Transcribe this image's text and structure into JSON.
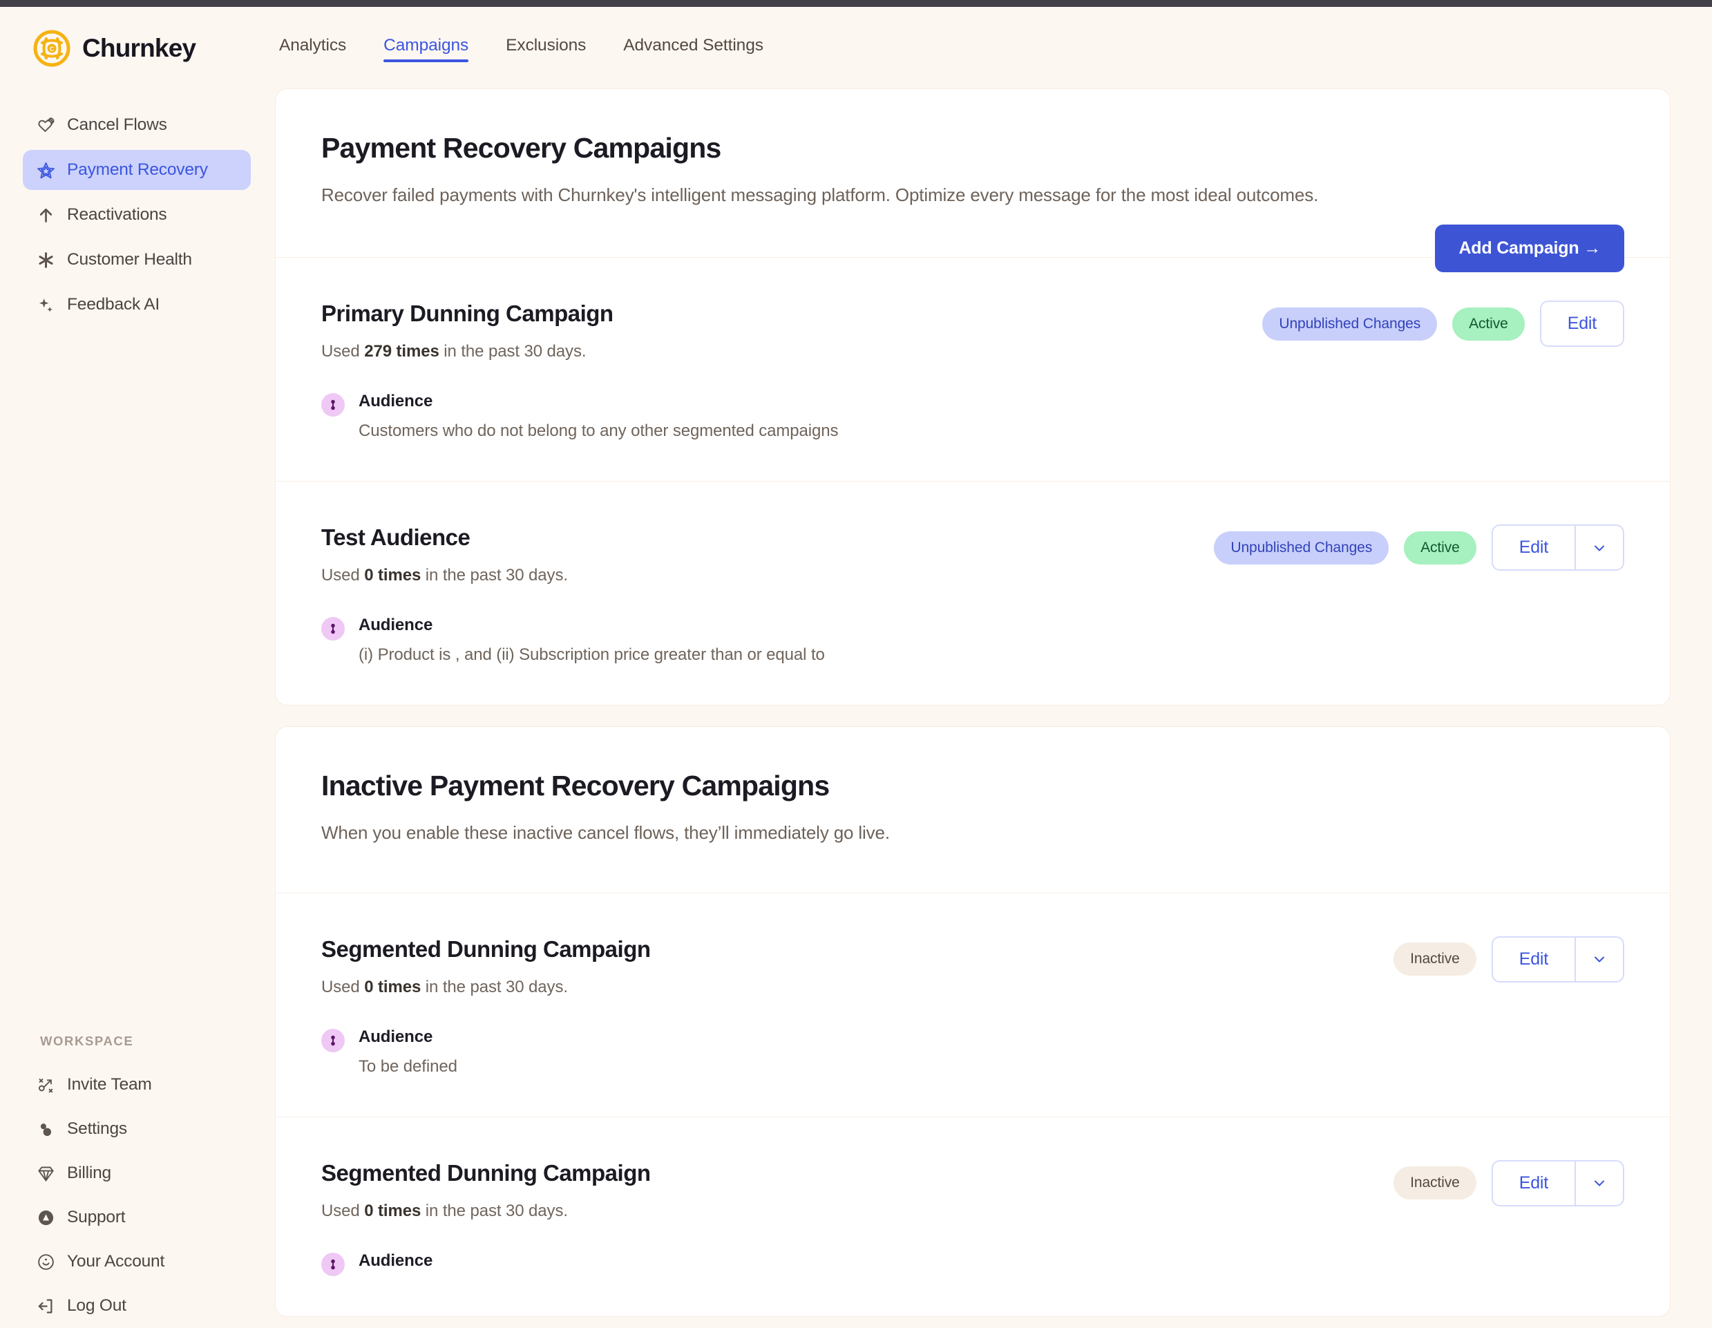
{
  "brand": {
    "name": "Churnkey",
    "logo_icon": "churnkey-logo-icon"
  },
  "topnav": {
    "items": [
      {
        "label": "Analytics",
        "active": false
      },
      {
        "label": "Campaigns",
        "active": true
      },
      {
        "label": "Exclusions",
        "active": false
      },
      {
        "label": "Advanced Settings",
        "active": false
      }
    ]
  },
  "sidebar": {
    "primary": [
      {
        "label": "Cancel Flows",
        "icon": "heart-stack-icon",
        "active": false
      },
      {
        "label": "Payment Recovery",
        "icon": "star-outline-icon",
        "active": true
      },
      {
        "label": "Reactivations",
        "icon": "arrow-up-icon",
        "active": false
      },
      {
        "label": "Customer Health",
        "icon": "asterisk-icon",
        "active": false
      },
      {
        "label": "Feedback AI",
        "icon": "sparkles-icon",
        "active": false
      }
    ],
    "workspace_label": "WORKSPACE",
    "secondary": [
      {
        "label": "Invite Team",
        "icon": "invite-team-icon"
      },
      {
        "label": "Settings",
        "icon": "settings-dots-icon"
      },
      {
        "label": "Billing",
        "icon": "diamond-icon"
      },
      {
        "label": "Support",
        "icon": "support-circle-icon"
      },
      {
        "label": "Your Account",
        "icon": "account-face-icon"
      },
      {
        "label": "Log Out",
        "icon": "logout-icon"
      }
    ]
  },
  "main": {
    "active_section": {
      "title": "Payment Recovery Campaigns",
      "description": "Recover failed payments with Churnkey's intelligent messaging platform. Optimize every message for the most ideal outcomes.",
      "add_button": "Add Campaign →",
      "campaigns": [
        {
          "name": "Primary Dunning Campaign",
          "usage_prefix": "Used ",
          "usage_count": "279 times",
          "usage_suffix": " in the past 30 days.",
          "audience_label": "Audience",
          "audience_detail": "Customers who do not belong to any other segmented campaigns",
          "badges": [
            {
              "text": "Unpublished Changes",
              "type": "unpublished"
            },
            {
              "text": "Active",
              "type": "active"
            }
          ],
          "edit_label": "Edit",
          "has_caret": false
        },
        {
          "name": "Test Audience",
          "usage_prefix": "Used ",
          "usage_count": "0 times",
          "usage_suffix": " in the past 30 days.",
          "audience_label": "Audience",
          "audience_detail": "(i) Product is , and (ii) Subscription price greater than or equal to",
          "badges": [
            {
              "text": "Unpublished Changes",
              "type": "unpublished"
            },
            {
              "text": "Active",
              "type": "active"
            }
          ],
          "edit_label": "Edit",
          "has_caret": true
        }
      ]
    },
    "inactive_section": {
      "title": "Inactive Payment Recovery Campaigns",
      "description": "When you enable these inactive cancel flows, they’ll immediately go live.",
      "campaigns": [
        {
          "name": "Segmented Dunning Campaign",
          "usage_prefix": "Used ",
          "usage_count": "0 times",
          "usage_suffix": " in the past 30 days.",
          "audience_label": "Audience",
          "audience_detail": "To be defined",
          "badges": [
            {
              "text": "Inactive",
              "type": "inactive"
            }
          ],
          "edit_label": "Edit",
          "has_caret": true
        },
        {
          "name": "Segmented Dunning Campaign",
          "usage_prefix": "Used ",
          "usage_count": "0 times",
          "usage_suffix": " in the past 30 days.",
          "audience_label": "Audience",
          "audience_detail": "",
          "badges": [
            {
              "text": "Inactive",
              "type": "inactive"
            }
          ],
          "edit_label": "Edit",
          "has_caret": true
        }
      ]
    }
  },
  "colors": {
    "accent_blue": "#3b55e0",
    "brand_yellow": "#f5b312",
    "page_bg": "#fdf7f2",
    "card_bg": "#ffffff",
    "badge_active_bg": "#a7f0c0",
    "badge_unpublished_bg": "#c8cffb",
    "badge_inactive_bg": "#f5ece3",
    "audience_icon_bg": "#efc8f5"
  }
}
